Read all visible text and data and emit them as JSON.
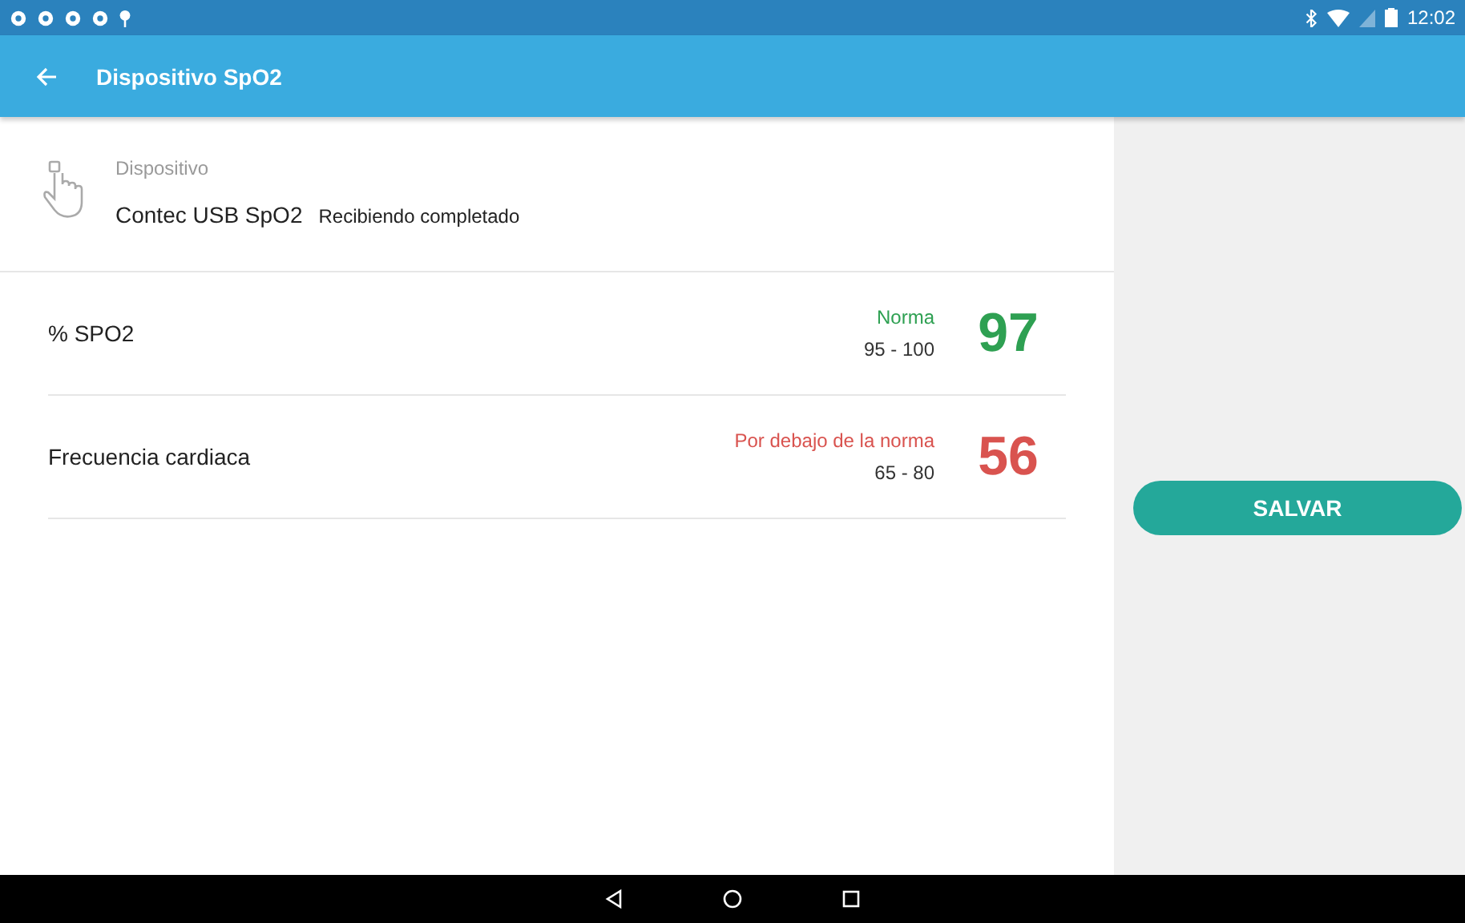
{
  "status_bar": {
    "time": "12:02"
  },
  "app_bar": {
    "title": "Dispositivo SpO2"
  },
  "device": {
    "label": "Dispositivo",
    "name": "Contec USB SpO2",
    "status": "Recibiendo completado"
  },
  "measurements": [
    {
      "name": "% SPO2",
      "status": "Norma",
      "range": "95 - 100",
      "value": "97",
      "color": "#2ea052"
    },
    {
      "name": "Frecuencia cardiaca",
      "status": "Por debajo de la norma",
      "range": "65 - 80",
      "value": "56",
      "color": "#d9534f"
    }
  ],
  "save_button": "SALVAR"
}
